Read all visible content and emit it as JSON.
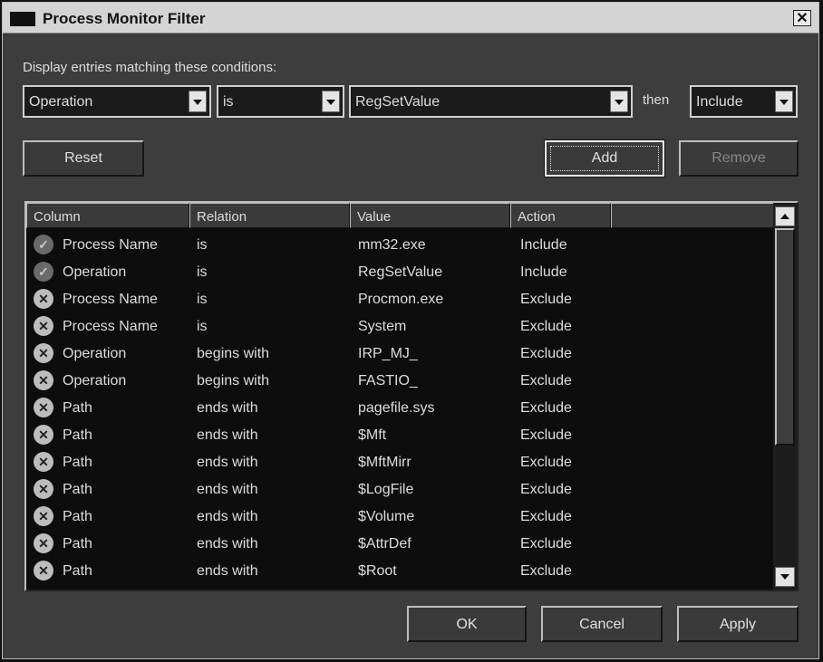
{
  "window": {
    "title": "Process Monitor Filter",
    "close_label": "✕"
  },
  "prompt": "Display entries matching these conditions:",
  "filter": {
    "column": "Operation",
    "relation": "is",
    "value": "RegSetValue",
    "then_label": "then",
    "action": "Include"
  },
  "buttons": {
    "reset": "Reset",
    "add": "Add",
    "remove": "Remove",
    "ok": "OK",
    "cancel": "Cancel",
    "apply": "Apply"
  },
  "table": {
    "headers": [
      "Column",
      "Relation",
      "Value",
      "Action"
    ],
    "rows": [
      {
        "status": "include",
        "column": "Process Name",
        "relation": "is",
        "value": "mm32.exe",
        "action": "Include"
      },
      {
        "status": "include",
        "column": "Operation",
        "relation": "is",
        "value": "RegSetValue",
        "action": "Include"
      },
      {
        "status": "exclude",
        "column": "Process Name",
        "relation": "is",
        "value": "Procmon.exe",
        "action": "Exclude"
      },
      {
        "status": "exclude",
        "column": "Process Name",
        "relation": "is",
        "value": "System",
        "action": "Exclude"
      },
      {
        "status": "exclude",
        "column": "Operation",
        "relation": "begins with",
        "value": "IRP_MJ_",
        "action": "Exclude"
      },
      {
        "status": "exclude",
        "column": "Operation",
        "relation": "begins with",
        "value": "FASTIO_",
        "action": "Exclude"
      },
      {
        "status": "exclude",
        "column": "Path",
        "relation": "ends with",
        "value": "pagefile.sys",
        "action": "Exclude"
      },
      {
        "status": "exclude",
        "column": "Path",
        "relation": "ends with",
        "value": "$Mft",
        "action": "Exclude"
      },
      {
        "status": "exclude",
        "column": "Path",
        "relation": "ends with",
        "value": "$MftMirr",
        "action": "Exclude"
      },
      {
        "status": "exclude",
        "column": "Path",
        "relation": "ends with",
        "value": "$LogFile",
        "action": "Exclude"
      },
      {
        "status": "exclude",
        "column": "Path",
        "relation": "ends with",
        "value": "$Volume",
        "action": "Exclude"
      },
      {
        "status": "exclude",
        "column": "Path",
        "relation": "ends with",
        "value": "$AttrDef",
        "action": "Exclude"
      },
      {
        "status": "exclude",
        "column": "Path",
        "relation": "ends with",
        "value": "$Root",
        "action": "Exclude"
      }
    ]
  }
}
